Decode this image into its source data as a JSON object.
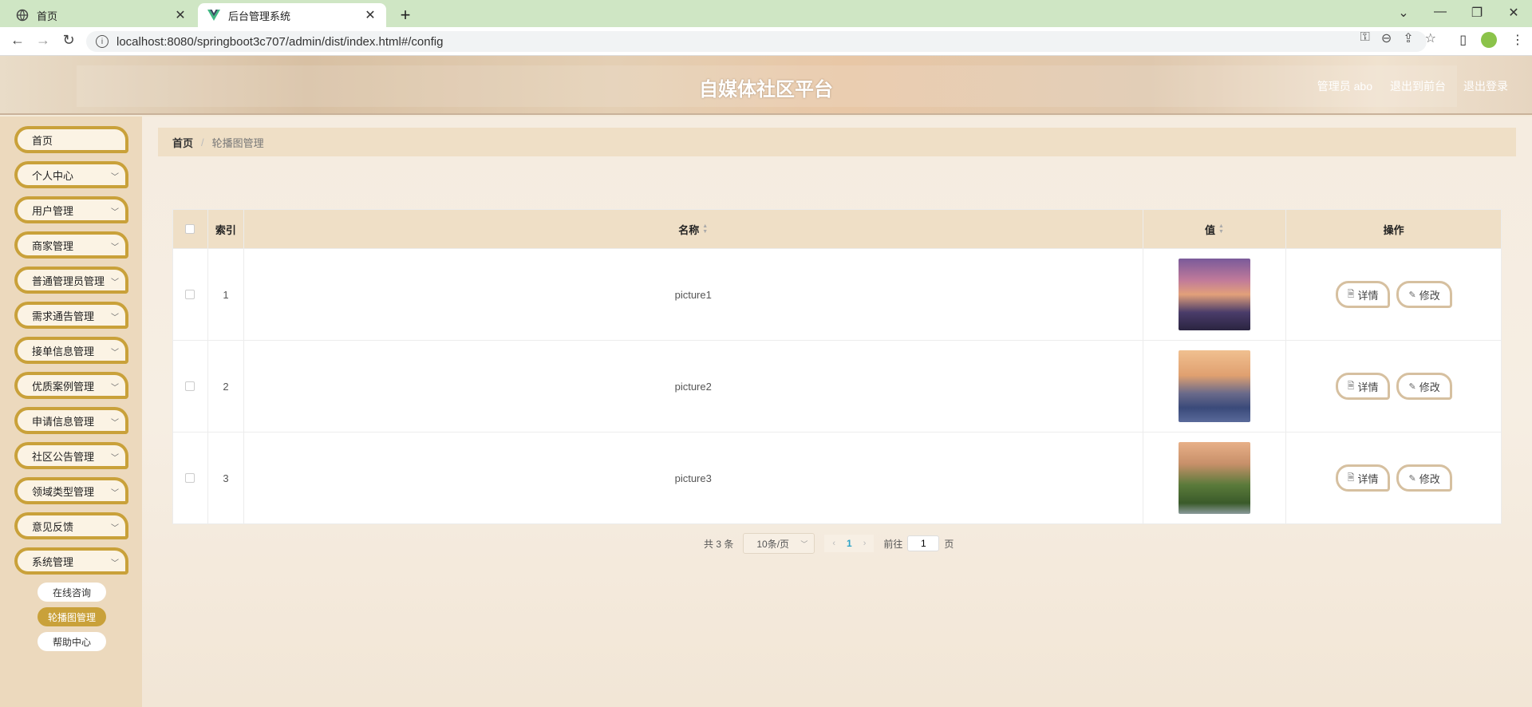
{
  "browser": {
    "tabs": [
      {
        "title": "首页",
        "active": false
      },
      {
        "title": "后台管理系统",
        "active": true
      }
    ],
    "url": "localhost:8080/springboot3c707/admin/dist/index.html#/config"
  },
  "header": {
    "site_title": "自媒体社区平台",
    "user_label": "管理员 abo",
    "back_label": "退出到前台",
    "logout_label": "退出登录"
  },
  "sidebar": {
    "items": [
      {
        "label": "首页",
        "has_children": false
      },
      {
        "label": "个人中心",
        "has_children": true
      },
      {
        "label": "用户管理",
        "has_children": true
      },
      {
        "label": "商家管理",
        "has_children": true
      },
      {
        "label": "普通管理员管理",
        "has_children": true
      },
      {
        "label": "需求通告管理",
        "has_children": true
      },
      {
        "label": "接单信息管理",
        "has_children": true
      },
      {
        "label": "优质案例管理",
        "has_children": true
      },
      {
        "label": "申请信息管理",
        "has_children": true
      },
      {
        "label": "社区公告管理",
        "has_children": true
      },
      {
        "label": "领域类型管理",
        "has_children": true
      },
      {
        "label": "意见反馈",
        "has_children": true
      },
      {
        "label": "系统管理",
        "has_children": true
      }
    ],
    "submenu": [
      {
        "label": "在线咨询",
        "active": false
      },
      {
        "label": "轮播图管理",
        "active": true
      },
      {
        "label": "帮助中心",
        "active": false
      }
    ]
  },
  "breadcrumb": {
    "home": "首页",
    "sep": "/",
    "current": "轮播图管理"
  },
  "table": {
    "columns": {
      "index": "索引",
      "name": "名称",
      "value": "值",
      "actions": "操作"
    },
    "rows": [
      {
        "index": "1",
        "name": "picture1"
      },
      {
        "index": "2",
        "name": "picture2"
      },
      {
        "index": "3",
        "name": "picture3"
      }
    ],
    "detail_label": "详情",
    "edit_label": "修改"
  },
  "pagination": {
    "total": "共 3 条",
    "page_size": "10条/页",
    "current_page": "1",
    "goto_prefix": "前往",
    "goto_value": "1",
    "goto_suffix": "页"
  },
  "colors": {
    "accent": "#c9a13a",
    "header_bg": "#efdfc6",
    "sidebar_bg": "#ecd9bd",
    "tabbar_bg": "#cfe6c4"
  }
}
